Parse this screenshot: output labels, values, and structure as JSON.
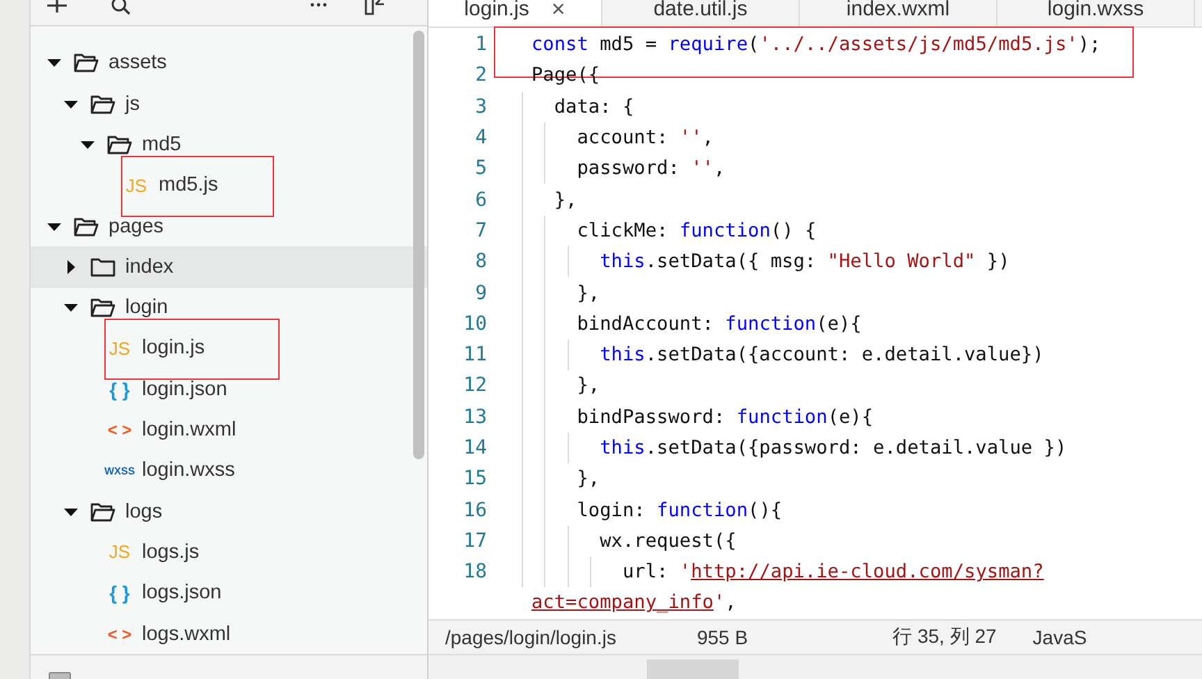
{
  "sidebar": {
    "tree": [
      {
        "name": "assets",
        "kind": "folder",
        "expanded": true,
        "selected": false,
        "children": [
          {
            "name": "js",
            "kind": "folder",
            "expanded": true,
            "selected": false,
            "children": [
              {
                "name": "md5",
                "kind": "folder",
                "expanded": true,
                "selected": false,
                "children": [
                  {
                    "name": "md5.js",
                    "kind": "js",
                    "icon_text": "JS",
                    "selected": false,
                    "highlighted": true
                  }
                ]
              }
            ]
          }
        ]
      },
      {
        "name": "pages",
        "kind": "folder",
        "expanded": true,
        "selected": false,
        "children": [
          {
            "name": "index",
            "kind": "folder",
            "expanded": false,
            "selected": true
          },
          {
            "name": "login",
            "kind": "folder",
            "expanded": true,
            "selected": false,
            "children": [
              {
                "name": "login.js",
                "kind": "js",
                "icon_text": "JS",
                "selected": false,
                "highlighted": true
              },
              {
                "name": "login.json",
                "kind": "json",
                "icon_text": "{ }",
                "selected": false
              },
              {
                "name": "login.wxml",
                "kind": "wxml",
                "icon_text": "< >",
                "selected": false
              },
              {
                "name": "login.wxss",
                "kind": "wxss",
                "icon_text": "WXSS",
                "selected": false
              }
            ]
          },
          {
            "name": "logs",
            "kind": "folder",
            "expanded": true,
            "selected": false,
            "children": [
              {
                "name": "logs.js",
                "kind": "js",
                "icon_text": "JS",
                "selected": false
              },
              {
                "name": "logs.json",
                "kind": "json",
                "icon_text": "{ }",
                "selected": false
              },
              {
                "name": "logs.wxml",
                "kind": "wxml",
                "icon_text": "< >",
                "selected": false
              }
            ]
          }
        ]
      }
    ]
  },
  "editor": {
    "tabs": [
      {
        "label": "login.js",
        "selected": true,
        "closable": true,
        "close_text": "×"
      },
      {
        "label": "date.util.js",
        "selected": false,
        "closable": false
      },
      {
        "label": "index.wxml",
        "selected": false,
        "closable": false
      },
      {
        "label": "login.wxss",
        "selected": false,
        "closable": false
      }
    ],
    "lines": [
      {
        "number": "1",
        "highlighted": true,
        "tokens": [
          {
            "kind": "keyword",
            "text": "const"
          },
          {
            "kind": "plain",
            "text": " md5 = "
          },
          {
            "kind": "keyword",
            "text": "require"
          },
          {
            "kind": "plain",
            "text": "("
          },
          {
            "kind": "string",
            "text": "'../../assets/js/md5/md5.js'"
          },
          {
            "kind": "plain",
            "text": ");"
          }
        ]
      },
      {
        "number": "2",
        "tokens": [
          {
            "kind": "plain",
            "text": "Page({"
          }
        ]
      },
      {
        "number": "3",
        "tokens": [
          {
            "kind": "plain",
            "text": "  data: {"
          }
        ]
      },
      {
        "number": "4",
        "tokens": [
          {
            "kind": "plain",
            "text": "    account: "
          },
          {
            "kind": "string",
            "text": "''"
          },
          {
            "kind": "plain",
            "text": ","
          }
        ]
      },
      {
        "number": "5",
        "tokens": [
          {
            "kind": "plain",
            "text": "    password: "
          },
          {
            "kind": "string",
            "text": "''"
          },
          {
            "kind": "plain",
            "text": ","
          }
        ]
      },
      {
        "number": "6",
        "tokens": [
          {
            "kind": "plain",
            "text": "  },"
          }
        ]
      },
      {
        "number": "7",
        "tokens": [
          {
            "kind": "plain",
            "text": "    clickMe: "
          },
          {
            "kind": "keyword",
            "text": "function"
          },
          {
            "kind": "plain",
            "text": "() {"
          }
        ]
      },
      {
        "number": "8",
        "tokens": [
          {
            "kind": "keyword",
            "text": "      this"
          },
          {
            "kind": "plain",
            "text": ".setData({ msg: "
          },
          {
            "kind": "string",
            "text": "\"Hello World\""
          },
          {
            "kind": "plain",
            "text": " })"
          }
        ]
      },
      {
        "number": "9",
        "tokens": [
          {
            "kind": "plain",
            "text": "    },"
          }
        ]
      },
      {
        "number": "10",
        "tokens": [
          {
            "kind": "plain",
            "text": "    bindAccount: "
          },
          {
            "kind": "keyword",
            "text": "function"
          },
          {
            "kind": "plain",
            "text": "(e){"
          }
        ]
      },
      {
        "number": "11",
        "tokens": [
          {
            "kind": "keyword",
            "text": "      this"
          },
          {
            "kind": "plain",
            "text": ".setData({account: e.detail.value})"
          }
        ]
      },
      {
        "number": "12",
        "tokens": [
          {
            "kind": "plain",
            "text": "    },"
          }
        ]
      },
      {
        "number": "13",
        "tokens": [
          {
            "kind": "plain",
            "text": "    bindPassword: "
          },
          {
            "kind": "keyword",
            "text": "function"
          },
          {
            "kind": "plain",
            "text": "(e){"
          }
        ]
      },
      {
        "number": "14",
        "tokens": [
          {
            "kind": "keyword",
            "text": "      this"
          },
          {
            "kind": "plain",
            "text": ".setData({password: e.detail.value })"
          }
        ]
      },
      {
        "number": "15",
        "tokens": [
          {
            "kind": "plain",
            "text": "    },"
          }
        ]
      },
      {
        "number": "16",
        "tokens": [
          {
            "kind": "plain",
            "text": "    login: "
          },
          {
            "kind": "keyword",
            "text": "function"
          },
          {
            "kind": "plain",
            "text": "(){"
          }
        ]
      },
      {
        "number": "17",
        "tokens": [
          {
            "kind": "plain",
            "text": "      wx.request({"
          }
        ]
      },
      {
        "number": "18",
        "tokens": [
          {
            "kind": "plain",
            "text": "        url: "
          },
          {
            "kind": "string",
            "text": "'"
          },
          {
            "kind": "link",
            "text": "http://api.ie-cloud.com/sysman?"
          }
        ],
        "continuation": [
          {
            "kind": "link",
            "text": "act=company_info"
          },
          {
            "kind": "string",
            "text": "'"
          },
          {
            "kind": "plain",
            "text": ","
          }
        ]
      }
    ]
  },
  "status_bar": {
    "path": "/pages/login/login.js",
    "size": "955 B",
    "position": "行 35, 列 27",
    "language": "JavaS"
  }
}
